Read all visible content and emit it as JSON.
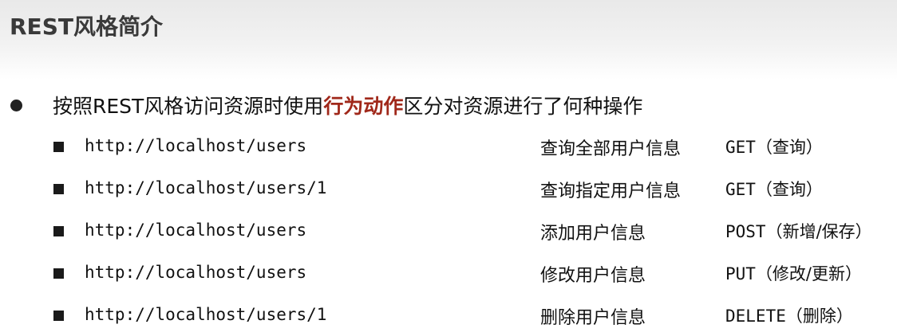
{
  "slide": {
    "title": "REST风格简介"
  },
  "intro": {
    "text_before": "按照REST风格访问资源时使用",
    "highlight": "行为动作",
    "text_after": "区分对资源进行了何种操作",
    "highlight_color": "#a0281a"
  },
  "rows": [
    {
      "url": "http://localhost/users",
      "desc": "查询全部用户信息",
      "method": "GET",
      "note": "（查询）"
    },
    {
      "url": "http://localhost/users/1",
      "desc": "查询指定用户信息",
      "method": "GET",
      "note": "（查询）"
    },
    {
      "url": "http://localhost/users",
      "desc": "添加用户信息",
      "method": "POST",
      "note": "（新增/保存）"
    },
    {
      "url": "http://localhost/users",
      "desc": "修改用户信息",
      "method": "PUT",
      "note": "（修改/更新）"
    },
    {
      "url": "http://localhost/users/1",
      "desc": "删除用户信息",
      "method": "DELETE",
      "note": "（删除）"
    }
  ]
}
